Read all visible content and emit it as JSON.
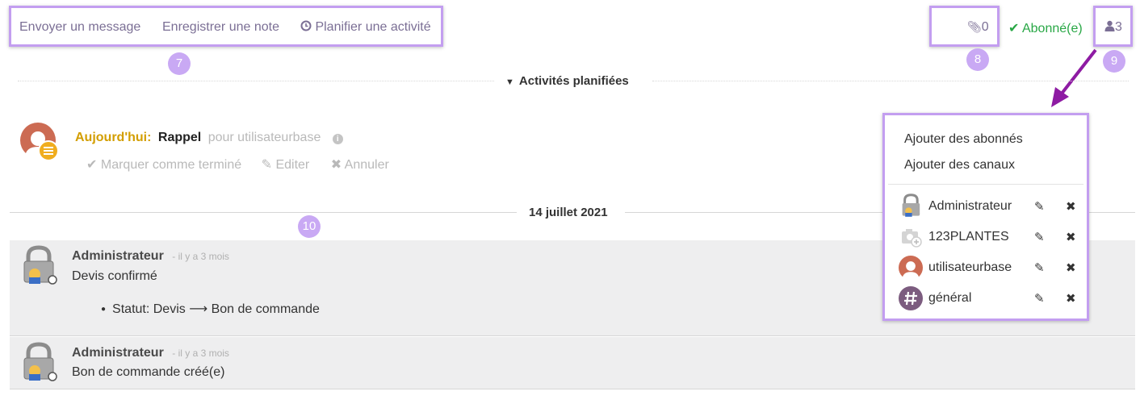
{
  "topbar": {
    "send_message": "Envoyer un message",
    "log_note": "Enregistrer une note",
    "schedule_activity": "Planifier une activité",
    "attachments_count": "0",
    "follow_status": "Abonné(e)",
    "followers_count": "3"
  },
  "callouts": [
    "7",
    "8",
    "9",
    "10"
  ],
  "activities": {
    "header": "Activités planifiées",
    "item": {
      "due": "Aujourd'hui:",
      "type": "Rappel",
      "for": "pour utilisateurbase",
      "mark_done": "Marquer comme terminé",
      "edit": "Editer",
      "cancel": "Annuler"
    }
  },
  "date_separator": "14 juillet 2021",
  "messages": [
    {
      "author": "Administrateur",
      "ago": "- il y a 3 mois",
      "body": "Devis confirmé",
      "tracking": {
        "field": "Statut: Devis",
        "new_value": "Bon de commande"
      }
    },
    {
      "author": "Administrateur",
      "ago": "- il y a 3 mois",
      "body": "Bon de commande créé(e)"
    }
  ],
  "followers_dropdown": {
    "add_followers": "Ajouter des abonnés",
    "add_channels": "Ajouter des canaux",
    "followers": [
      {
        "name": "Administrateur",
        "avatar": "lock-avatar"
      },
      {
        "name": "123PLANTES",
        "avatar": "camera-placeholder"
      },
      {
        "name": "utilisateurbase",
        "avatar": "user-silhouette"
      },
      {
        "name": "général",
        "avatar": "hash-channel"
      }
    ]
  },
  "colors": {
    "callout_border": "#c39ef0",
    "callout_badge": "#c9a9f4",
    "follow_green": "#28a745",
    "due_today": "#d39e00",
    "arrow": "#8e1ba3"
  }
}
